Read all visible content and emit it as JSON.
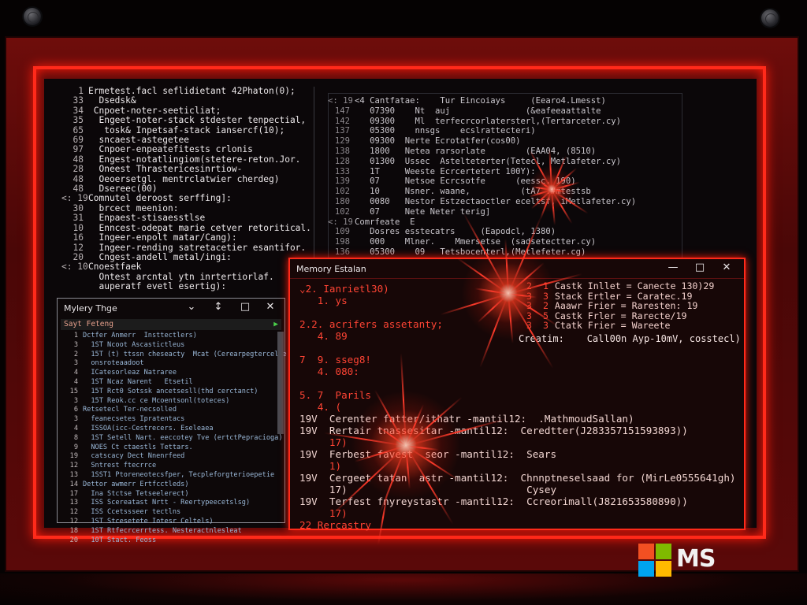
{
  "colors": {
    "accent": "#ff2a1a",
    "frame": "#5a0909",
    "screen": "#0b0709",
    "ms_red": "#f25022",
    "ms_green": "#7fba00",
    "ms_blue": "#00a4ef",
    "ms_yellow": "#ffb900"
  },
  "left_editor": {
    "lines": [
      {
        "n": "1",
        "t": "Ermetest.facl seflidietant 42Phaton(0);"
      },
      {
        "n": "33",
        "t": "  Dsedsk&"
      },
      {
        "n": "34",
        "t": " Cnpoet-noter-seeticliat;"
      },
      {
        "n": "35",
        "t": "  Engeet-noter-stack stdester tenpectial,"
      },
      {
        "n": "65",
        "t": "   tosk& Inpetsaf-stack iansercf(10);"
      },
      {
        "n": "69",
        "t": "  sncaest-astegetee"
      },
      {
        "n": "97",
        "t": "  Cnpoer-enpeatefitests crlonis"
      },
      {
        "n": "48",
        "t": "  Engest-notatlingiom(stetere-reton.Jor."
      },
      {
        "n": "28",
        "t": "  Oneest Thrastericesinrtiow-"
      },
      {
        "n": "48",
        "t": "  Oeoersetgl. mentrclatwier cherdeg)"
      },
      {
        "n": "48",
        "t": "  Dsereec(00)"
      },
      {
        "n": "<: 19",
        "t": "Comnutel deroost serffing]:"
      },
      {
        "n": "30",
        "t": "  brcect meenion:"
      },
      {
        "n": "31",
        "t": "  Enpaest-stisaesstlse"
      },
      {
        "n": "10",
        "t": "  Enncest-odepat marie cetver retoritical."
      },
      {
        "n": "16",
        "t": "  Ingeer-enpolt matar/Cang):"
      },
      {
        "n": "12",
        "t": "  Ingeer-rending satretacetier esantifor."
      },
      {
        "n": "20",
        "t": "  Cngest-andell metal/ingi:"
      },
      {
        "n": "<: 10",
        "t": "Cnoestfaek"
      },
      {
        "n": "",
        "t": "  Ontest arcntal ytn inrtertiorlaf."
      },
      {
        "n": "",
        "t": "  auperatf evetl esertig):"
      }
    ]
  },
  "right_editor": {
    "lines": [
      {
        "n": "<: 19",
        "t": "<4 Cantfatae:    Tur Eincoiays     (Eearo4.Lmesst)"
      },
      {
        "n": "147",
        "t": "   07390    Nt  auj               (&eafeeaattalte"
      },
      {
        "n": "142",
        "t": "   09300    Ml  terfecrcorlatersterl,(Tertarceter.cy)"
      },
      {
        "n": "137",
        "t": "   05300    nnsgs    ecslrattecteri)"
      },
      {
        "n": "129",
        "t": "   09300  Nerte Ecrotatfer(cos00)"
      },
      {
        "n": "138",
        "t": "   1800   Netea rarsorlate        (EAA04, (8510)"
      },
      {
        "n": "128",
        "t": "   01300  Ussec  Astelteterter(Tetecl, Metlafeter.cy)"
      },
      {
        "n": "133",
        "t": "   1T     Weeste Ecrcertetert 100Y):"
      },
      {
        "n": "139",
        "t": "   07     Netsoe Ecrcsotfe      (eessc. 190)"
      },
      {
        "n": "102",
        "t": "   10     Nsner. waane,          (tA7 .#mtestsb"
      },
      {
        "n": "180",
        "t": "   0080   Nestor Estzectaoctler eceltsf, iMetlafeter.cy)"
      },
      {
        "n": "102",
        "t": "   07     Nete Neter terig]"
      },
      {
        "n": "<: 19",
        "t": "Comrfeate  E"
      },
      {
        "n": "109",
        "t": "   Dosres esstecatrs     (Eapodcl, 1380)"
      },
      {
        "n": "198",
        "t": "   000    Mlner.    Mmersetse  (sadsetectter.cy)"
      },
      {
        "n": "136",
        "t": "   05300    09   Tetsbocenterl,(Metlefeter.cg)"
      }
    ]
  },
  "small_window": {
    "title": "Mylery Thge",
    "subbar": "Sayt Feteng",
    "controls": [
      "⌄",
      "↕",
      "□",
      "✕"
    ],
    "lines": [
      {
        "n": "1",
        "t": "Dctfer Anmerr  Insttectlers)",
        "hl": true
      },
      {
        "n": "3",
        "t": "  1ST Ncoot Ascastictleus",
        "hl": false
      },
      {
        "n": "2",
        "t": "  15T (t) ttssn cheseacty  Mcat (Cerearpegtercelie",
        "hl": false
      },
      {
        "n": "3",
        "t": "  onsroteaadoot",
        "hl": false
      },
      {
        "n": "4",
        "t": "  ICatesorleaz Natraree",
        "hl": false
      },
      {
        "n": "4",
        "t": "  1ST Ncaz Narent   Etsetil",
        "hl": false
      },
      {
        "n": "15",
        "t": "  15T Rct0 Sotssk ancetsesll(thd cerctanct)",
        "hl": false
      },
      {
        "n": "3",
        "t": "  15T Reok.cc ce Mcoentsonl(toteces)",
        "hl": false
      },
      {
        "n": "6",
        "t": "Retsetecl Ter-necsolled",
        "hl": true
      },
      {
        "n": "3",
        "t": "  feanecsetes Ipratentacs",
        "hl": false
      },
      {
        "n": "4",
        "t": "  ISSOA(icc-Cestrecers. Eseleaea",
        "hl": false
      },
      {
        "n": "8",
        "t": "  1ST Setell Nart. eeccotey Tve (ertctPepracioga)",
        "hl": false
      },
      {
        "n": "9",
        "t": "  NOES Ct ctaestls Tettars.",
        "hl": false
      },
      {
        "n": "19",
        "t": "  catscacy Dect Nnenrfeed",
        "hl": false
      },
      {
        "n": "12",
        "t": "  Sntrest ftecrrce",
        "hl": false
      },
      {
        "n": "13",
        "t": "  1SST1 Ptoreneotecsfper, Tecpleforgterioepetie",
        "hl": false
      },
      {
        "n": "14",
        "t": "Dettor awmerr Ertfcctleds)",
        "hl": true
      },
      {
        "n": "17",
        "t": "  Ina Stctse Tetseelerect)",
        "hl": false
      },
      {
        "n": "13",
        "t": "  ISS Scereatast Nrtt - Reertypeecetslsg)",
        "hl": false
      },
      {
        "n": "12",
        "t": "  ISS Ccetssseer tectlns",
        "hl": false
      },
      {
        "n": "12",
        "t": "  1ST Stcesetete Iotesr Celtels)",
        "hl": false
      },
      {
        "n": "18",
        "t": "  1ST Rtfecrcerrtess. Nesteractnlesleat",
        "hl": false
      },
      {
        "n": "20",
        "t": "  10T Stact. Feoss",
        "hl": false
      }
    ]
  },
  "memory_window": {
    "title": "Memory Estalan",
    "controls": [
      "—",
      "□",
      "✕"
    ],
    "items": [
      {
        "t": "⌄2. Ianrietl30)",
        "cls": "red"
      },
      {
        "t": "   1. ys",
        "cls": "red"
      },
      {
        "t": "",
        "cls": ""
      },
      {
        "t": "2.2. acrifers assetanty;",
        "cls": "red"
      },
      {
        "t": "   4. 89",
        "cls": "red"
      },
      {
        "t": "",
        "cls": ""
      },
      {
        "t": "7  9. sseg8!",
        "cls": "red"
      },
      {
        "t": "   4. 080:",
        "cls": "red"
      },
      {
        "t": "",
        "cls": ""
      },
      {
        "t": "5. 7  Parils",
        "cls": "red"
      },
      {
        "t": "   4. (",
        "cls": "red"
      },
      {
        "t": "19V  Cerenter fatter/ithatr -mantil12:  .MathmoudSallan)",
        "cls": "pale"
      },
      {
        "t": "19V  Rertair tnassesitar -mantil12:  Ceredtter(J283357151593893))",
        "cls": "pale"
      },
      {
        "t": "     17)",
        "cls": "red"
      },
      {
        "t": "19V  Ferbest favest  seor -mantil12:  Sears",
        "cls": "pale"
      },
      {
        "t": "     1)",
        "cls": "red"
      },
      {
        "t": "19V  Cergeet tatan  astr -mantil12:  Chnnptneselsaad for (MirLe0555641gh)",
        "cls": "pale"
      },
      {
        "t": "     17)                              Cysey",
        "cls": "pale"
      },
      {
        "t": "19V  Terfest fnyreystastr -mantil12:  Ccreorimall(J821653580890))",
        "cls": "pale"
      },
      {
        "t": "     17)",
        "cls": "red"
      },
      {
        "t": "22 Rercastry",
        "cls": "red"
      }
    ],
    "stack": [
      {
        "n": "2  1",
        "t": "Castk Inllet = Canecte 130)29"
      },
      {
        "n": "3  3",
        "t": "Stack Ertler = Caratec.19"
      },
      {
        "n": "3  2",
        "t": "Aaawr Frier = Raresten: 19"
      },
      {
        "n": "3  5",
        "t": "Castk Frler = Rarecte/19"
      },
      {
        "n": "3  3",
        "t": "Ctatk Frier = Wareete"
      }
    ],
    "create_line": "Creatim:    Call00n Ayp-10mV, cosstecl)"
  },
  "brand": {
    "text": "MS"
  }
}
